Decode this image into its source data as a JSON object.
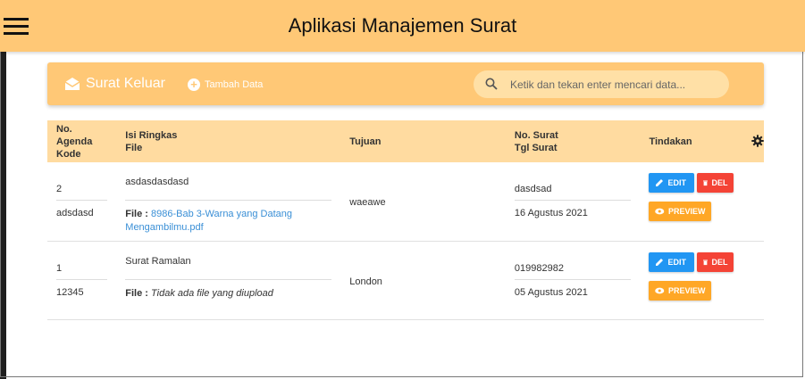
{
  "app": {
    "title": "Aplikasi Manajemen Surat"
  },
  "header": {
    "title": "Surat Keluar",
    "add_label": "Tambah Data",
    "search_placeholder": "Ketik dan tekan enter mencari data..."
  },
  "table": {
    "headers": {
      "col1_line1": "No. Agenda",
      "col1_line2": "Kode",
      "col2_line1": "Isi Ringkas",
      "col2_line2": "File",
      "col3": "Tujuan",
      "col4_line1": "No. Surat",
      "col4_line2": "Tgl Surat",
      "col5": "Tindakan"
    },
    "file_label": "File :",
    "actions": {
      "edit": "EDIT",
      "del": "DEL",
      "preview": "PREVIEW"
    },
    "rows": [
      {
        "no_agenda": "2",
        "kode": "adsdasd",
        "isi": "asdasdasdasd",
        "file_name": "8986-Bab 3-Warna yang Datang Mengambilmu.pdf",
        "tujuan": "waeawe",
        "no_surat": "dasdsad",
        "tgl_surat": "16 Agustus 2021"
      },
      {
        "no_agenda": "1",
        "kode": "12345",
        "isi": "Surat Ramalan",
        "file_name": "Tidak ada file yang diupload",
        "tujuan": "London",
        "no_surat": "019982982",
        "tgl_surat": "05 Agustus 2021"
      }
    ]
  },
  "colors": {
    "accent": "#ffc876",
    "edit": "#2196f3",
    "del": "#f44336",
    "preview": "#ffa726"
  },
  "icons": [
    "menu-icon",
    "envelope-open-icon",
    "plus-circle-icon",
    "search-icon",
    "gear-icon",
    "pencil-icon",
    "trash-icon",
    "eye-icon"
  ]
}
